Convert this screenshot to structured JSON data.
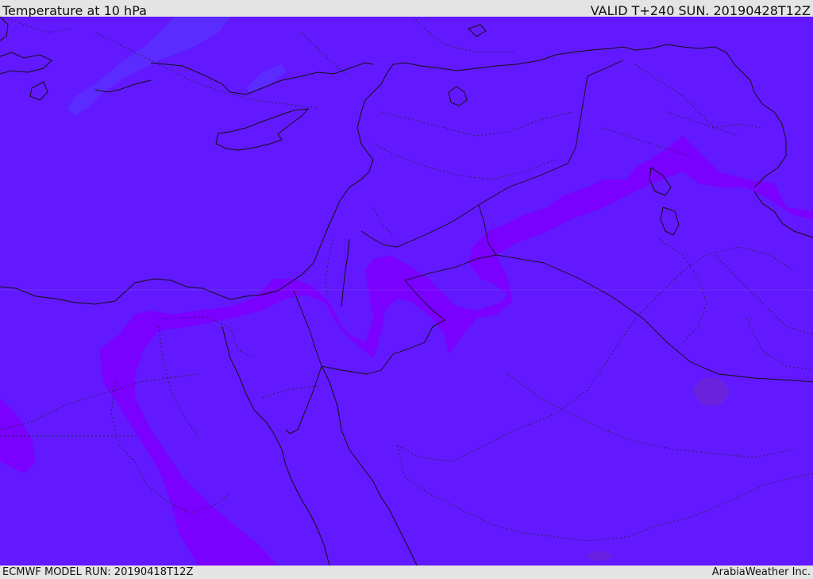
{
  "header": {
    "title": "Temperature at 10 hPa",
    "valid": "VALID T+240 SUN. 20190428T12Z"
  },
  "footer": {
    "model_run": "ECMWF MODEL RUN: 20190418T12Z",
    "credit": "ArabiaWeather Inc."
  },
  "map": {
    "field": "temperature",
    "level": "10 hPa",
    "colors": {
      "cold": "#6219ff",
      "colder": "#5b30ff",
      "warm": "#7a00ff",
      "warmest": "#6c24d6",
      "coastline": "#111111",
      "border": "#222244"
    }
  }
}
